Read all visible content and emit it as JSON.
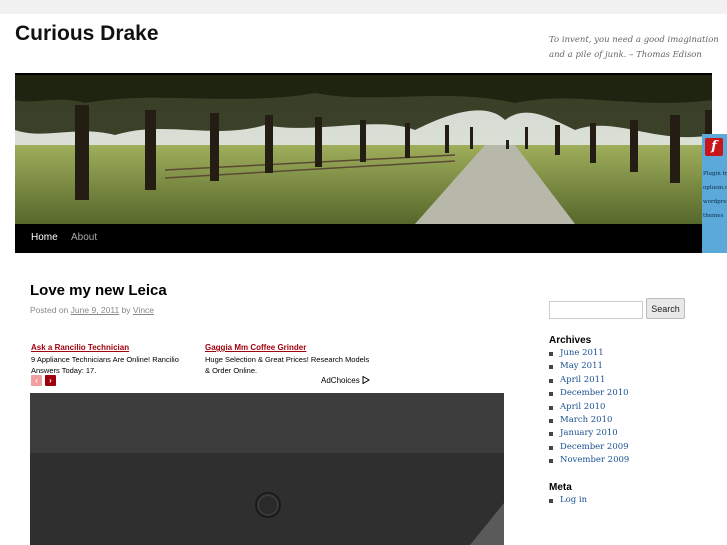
{
  "site": {
    "title": "Curious Drake",
    "description": "To invent, you need a good imagination and a pile of junk. – Thomas Edison"
  },
  "nav": {
    "items": [
      {
        "label": "Home",
        "active": true
      },
      {
        "label": "About",
        "active": false
      }
    ]
  },
  "flash_plugin": {
    "icon": "flash-icon",
    "glyph": "f",
    "text": "Plugin by oplusm.com wordpress themes"
  },
  "post": {
    "title": "Love my new Leica",
    "posted_on": "Posted on",
    "date": "June 9, 2011",
    "by": "by",
    "author": "Vince"
  },
  "ads": [
    {
      "title": "Ask a Rancilio Technician",
      "text": "9 Appliance Technicians Are Online! Rancilio Answers Today: 17."
    },
    {
      "title": "Gaggia Mm Coffee Grinder",
      "text": "Huge Selection & Great Prices! Research Models & Order Online."
    }
  ],
  "ad_nav": {
    "prev": "‹",
    "next": "›",
    "adchoices": "AdChoices"
  },
  "sidebar": {
    "search": {
      "value": "",
      "placeholder": "",
      "button": "Search"
    },
    "archives": {
      "title": "Archives",
      "items": [
        "June 2011",
        "May 2011",
        "April 2011",
        "December 2010",
        "April 2010",
        "March 2010",
        "January 2010",
        "December 2009",
        "November 2009"
      ]
    },
    "meta": {
      "title": "Meta",
      "items": [
        "Log in"
      ]
    }
  },
  "colors": {
    "navbar": "#000000",
    "link": "#1b5190",
    "ad_title": "#a0000e",
    "flash_panel": "#5aa9d8"
  }
}
